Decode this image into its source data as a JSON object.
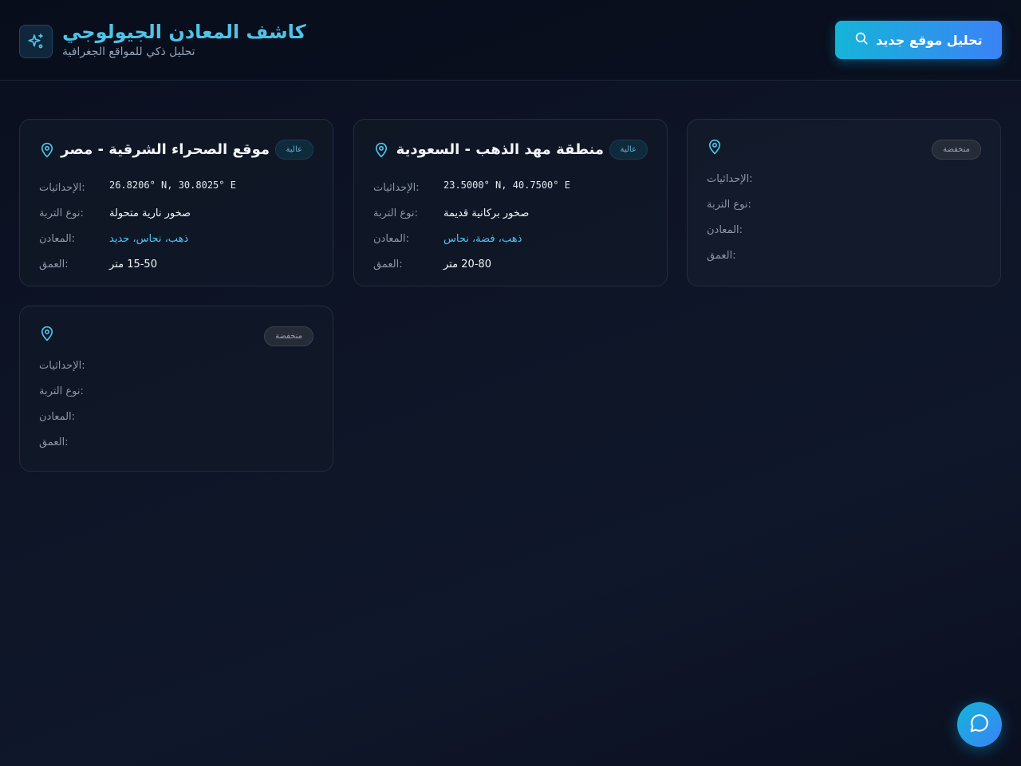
{
  "header": {
    "title": "كاشف المعادن الجيولوجي",
    "subtitle": "تحليل ذكي للمواقع الجغرافية",
    "logo_icon": "sparkles-icon",
    "new_analysis_label": "تحليل موقع جديد",
    "new_analysis_icon": "search-icon"
  },
  "labels": {
    "coordinates": "الإحداثيات:",
    "soil": "نوع التربة:",
    "minerals": "المعادن:",
    "depth": "العمق:"
  },
  "sites": [
    {
      "title": "موقع الصحراء الشرقية - مصر",
      "badge": "عالية",
      "badge_level": "high",
      "coordinates": "26.8206° N, 30.8025° E",
      "soil": "صخور نارية متحولة",
      "minerals": "ذهب، نحاس، حديد",
      "depth": "15-50 متر"
    },
    {
      "title": "منطقة مهد الذهب - السعودية",
      "badge": "عالية",
      "badge_level": "high",
      "coordinates": "23.5000° N, 40.7500° E",
      "soil": "صخور بركانية قديمة",
      "minerals": "ذهب، فضة، نحاس",
      "depth": "20-80 متر"
    },
    {
      "title": "",
      "badge": "منخفضة",
      "badge_level": "low",
      "coordinates": "",
      "soil": "",
      "minerals": "",
      "depth": ""
    },
    {
      "title": "",
      "badge": "منخفضة",
      "badge_level": "low",
      "coordinates": "",
      "soil": "",
      "minerals": "",
      "depth": ""
    }
  ],
  "chat": {
    "icon": "chat-bubble-icon"
  },
  "colors": {
    "accent": "#4fc3e8",
    "button_gradient_start": "#14b5d8",
    "button_gradient_end": "#3b82f6",
    "background": "#0b1020"
  }
}
